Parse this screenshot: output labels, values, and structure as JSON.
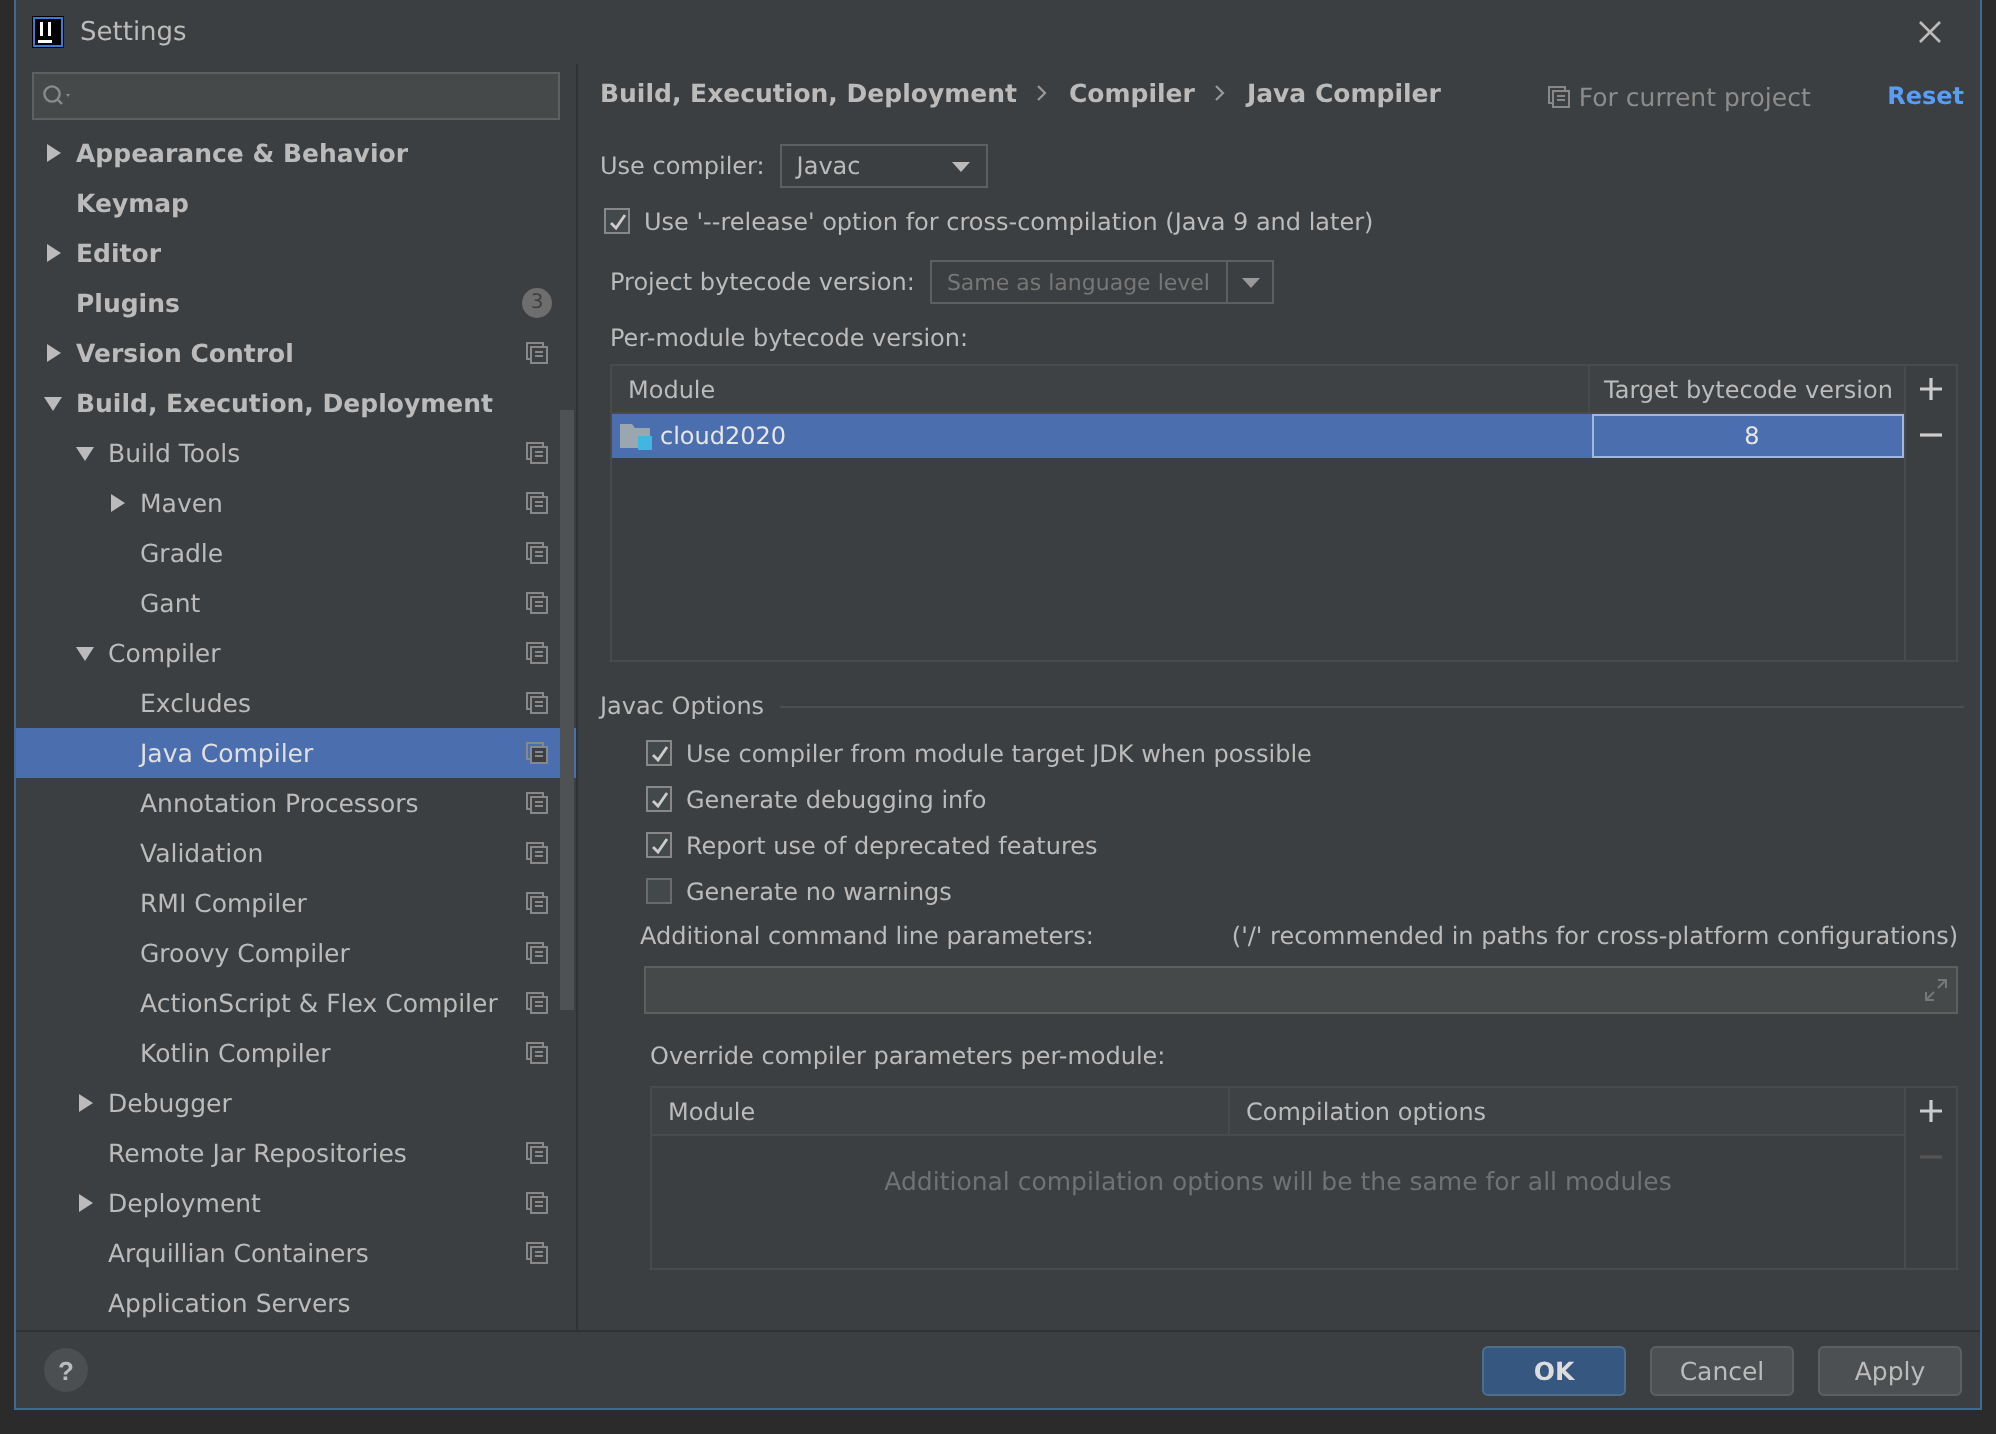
{
  "window": {
    "title": "Settings"
  },
  "sidebar": {
    "items": [
      {
        "label": "Appearance & Behavior",
        "expanded": false,
        "selected": false,
        "project_level": false
      },
      {
        "label": "Keymap",
        "selected": false,
        "project_level": false
      },
      {
        "label": "Editor",
        "expanded": false,
        "selected": false,
        "project_level": false
      },
      {
        "label": "Plugins",
        "selected": false,
        "project_level": false,
        "badge": "3"
      },
      {
        "label": "Version Control",
        "expanded": false,
        "selected": false,
        "project_level": true
      },
      {
        "label": "Build, Execution, Deployment",
        "expanded": true,
        "selected": false,
        "project_level": false,
        "children": [
          {
            "label": "Build Tools",
            "expanded": true,
            "selected": false,
            "project_level": true,
            "children": [
              {
                "label": "Maven",
                "expanded": false,
                "selected": false,
                "project_level": true
              },
              {
                "label": "Gradle",
                "selected": false,
                "project_level": true
              },
              {
                "label": "Gant",
                "selected": false,
                "project_level": true
              }
            ]
          },
          {
            "label": "Compiler",
            "expanded": true,
            "selected": false,
            "project_level": true,
            "children": [
              {
                "label": "Excludes",
                "selected": false,
                "project_level": true
              },
              {
                "label": "Java Compiler",
                "selected": true,
                "project_level": true
              },
              {
                "label": "Annotation Processors",
                "selected": false,
                "project_level": true
              },
              {
                "label": "Validation",
                "selected": false,
                "project_level": true
              },
              {
                "label": "RMI Compiler",
                "selected": false,
                "project_level": true
              },
              {
                "label": "Groovy Compiler",
                "selected": false,
                "project_level": true
              },
              {
                "label": "ActionScript & Flex Compiler",
                "selected": false,
                "project_level": true
              },
              {
                "label": "Kotlin Compiler",
                "selected": false,
                "project_level": true
              }
            ]
          },
          {
            "label": "Debugger",
            "expanded": false,
            "selected": false,
            "project_level": false
          },
          {
            "label": "Remote Jar Repositories",
            "selected": false,
            "project_level": true
          },
          {
            "label": "Deployment",
            "expanded": false,
            "selected": false,
            "project_level": true
          },
          {
            "label": "Arquillian Containers",
            "selected": false,
            "project_level": true
          },
          {
            "label": "Application Servers",
            "selected": false,
            "project_level": false
          }
        ]
      }
    ]
  },
  "breadcrumb": [
    "Build, Execution, Deployment",
    "Compiler",
    "Java Compiler"
  ],
  "scope_note": "For current project",
  "reset_link": "Reset",
  "use_compiler": {
    "label": "Use compiler:",
    "value": "Javac"
  },
  "release_option": {
    "label": "Use '--release' option for cross-compilation (Java 9 and later)",
    "checked": true
  },
  "project_bytecode": {
    "label": "Project bytecode version:",
    "value": "Same as language level",
    "disabled": true
  },
  "per_module": {
    "label": "Per-module bytecode version:",
    "columns": [
      "Module",
      "Target bytecode version"
    ],
    "rows": [
      {
        "module": "cloud2020",
        "version": "8",
        "selected": true
      }
    ]
  },
  "javac_options": {
    "title": "Javac Options",
    "checkboxes": [
      {
        "label": "Use compiler from module target JDK when possible",
        "checked": true
      },
      {
        "label": "Generate debugging info",
        "checked": true
      },
      {
        "label": "Report use of deprecated features",
        "checked": true
      },
      {
        "label": "Generate no warnings",
        "checked": false
      }
    ],
    "params_label": "Additional command line parameters:",
    "params_hint": "('/' recommended in paths for cross-platform configurations)",
    "override_label": "Override compiler parameters per-module:",
    "override_columns": [
      "Module",
      "Compilation options"
    ],
    "override_empty": "Additional compilation options will be the same for all modules"
  },
  "help_button": "?",
  "buttons": [
    {
      "label": "OK",
      "kind": "primary"
    },
    {
      "label": "Cancel",
      "kind": "normal"
    },
    {
      "label": "Apply",
      "kind": "normal"
    }
  ]
}
